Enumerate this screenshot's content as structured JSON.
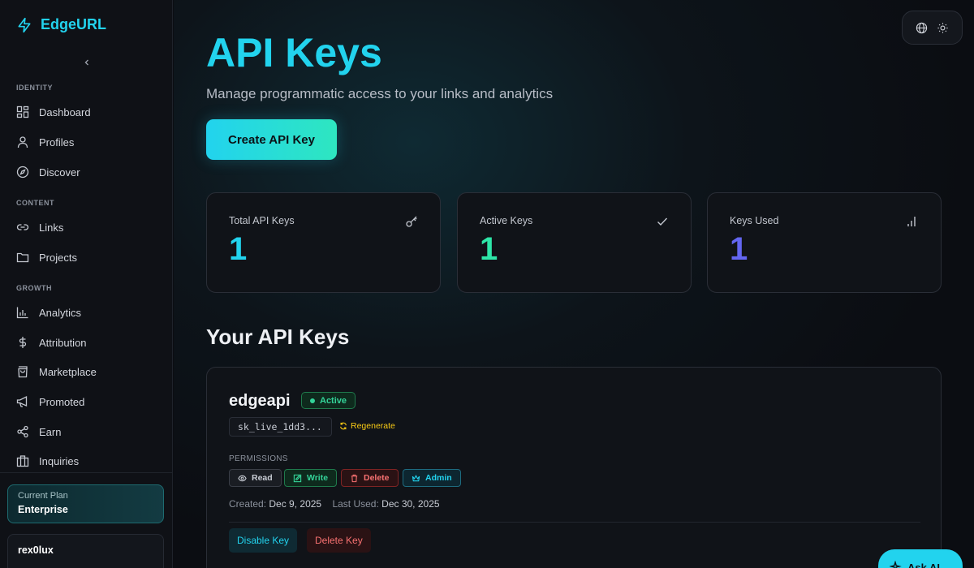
{
  "app": {
    "name": "EdgeURL"
  },
  "sidebar": {
    "sections": [
      {
        "label": "IDENTITY"
      },
      {
        "label": "CONTENT"
      },
      {
        "label": "GROWTH"
      }
    ],
    "items": [
      {
        "label": "Dashboard",
        "icon": "dashboard-icon"
      },
      {
        "label": "Profiles",
        "icon": "user-icon"
      },
      {
        "label": "Discover",
        "icon": "compass-icon"
      },
      {
        "label": "Links",
        "icon": "link-icon"
      },
      {
        "label": "Projects",
        "icon": "folder-icon"
      },
      {
        "label": "Analytics",
        "icon": "bar-chart-icon"
      },
      {
        "label": "Attribution",
        "icon": "dollar-icon"
      },
      {
        "label": "Marketplace",
        "icon": "shopping-bag-icon"
      },
      {
        "label": "Promoted",
        "icon": "megaphone-icon"
      },
      {
        "label": "Earn",
        "icon": "share-icon"
      },
      {
        "label": "Inquiries",
        "icon": "briefcase-icon"
      }
    ],
    "plan": {
      "label": "Current Plan",
      "name": "Enterprise"
    },
    "user": {
      "name": "rex0lux"
    }
  },
  "header": {
    "title": "API Keys",
    "subtitle": "Manage programmatic access to your links and analytics",
    "create_button": "Create API Key"
  },
  "stats": [
    {
      "label": "Total API Keys",
      "value": "1",
      "icon": "key-icon",
      "color": "#22d3ee"
    },
    {
      "label": "Active Keys",
      "value": "1",
      "icon": "check-icon",
      "color": "#2ee6a8"
    },
    {
      "label": "Keys Used",
      "value": "1",
      "icon": "signal-bars-icon",
      "color": "#6366f1"
    }
  ],
  "keys_section": {
    "title": "Your API Keys",
    "keys": [
      {
        "name": "edgeapi",
        "status": "Active",
        "key_preview": "sk_live_1dd3...",
        "regenerate_label": "Regenerate",
        "permissions_label": "PERMISSIONS",
        "permissions": [
          "Read",
          "Write",
          "Delete",
          "Admin"
        ],
        "created_label": "Created:",
        "created": "Dec 9, 2025",
        "last_used_label": "Last Used:",
        "last_used": "Dec 30, 2025",
        "disable_label": "Disable Key",
        "delete_label": "Delete Key"
      }
    ]
  },
  "ask_ai": {
    "label": "Ask AI"
  },
  "colors": {
    "accent": "#22d3ee",
    "success": "#34d399",
    "danger": "#f87171",
    "warning": "#facc15",
    "indigo": "#6366f1"
  }
}
